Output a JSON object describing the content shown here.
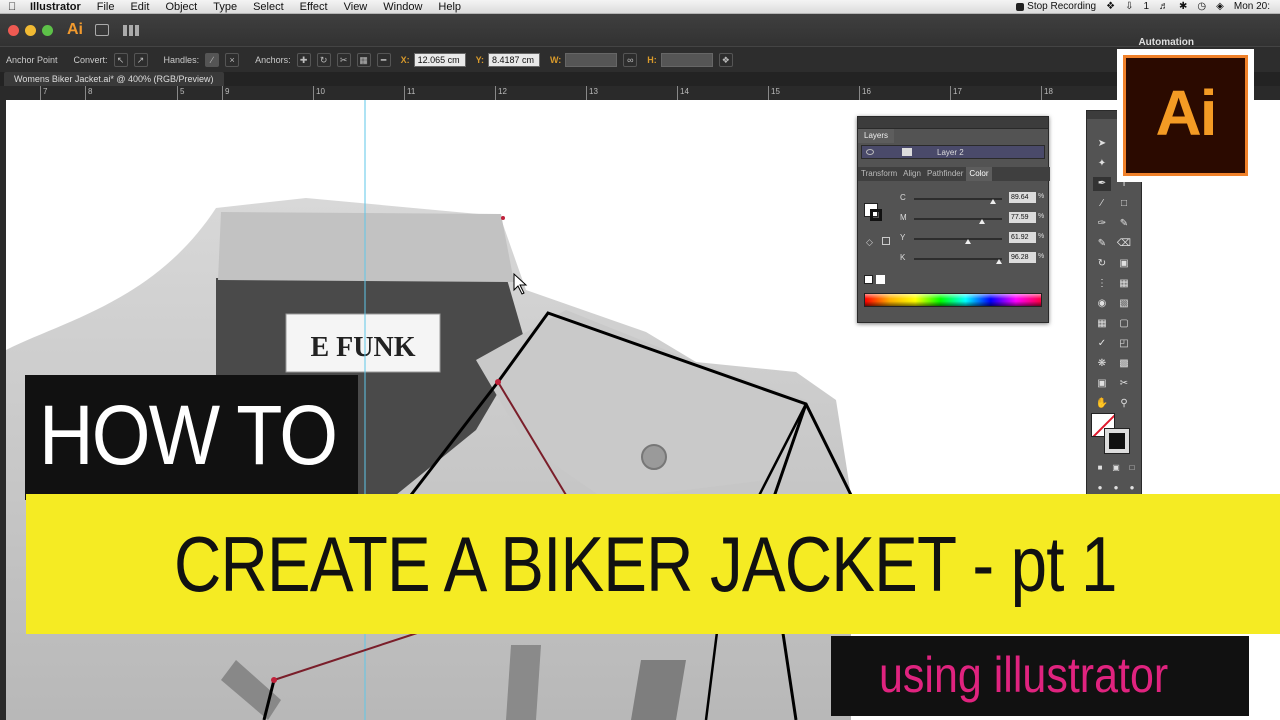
{
  "menubar": {
    "app_name": "Illustrator",
    "items": [
      "File",
      "Edit",
      "Object",
      "Type",
      "Select",
      "Effect",
      "View",
      "Window",
      "Help"
    ],
    "stop_recording": "Stop Recording",
    "clock": "Mon 20:",
    "input_badge": "1"
  },
  "appbar": {
    "logo_text": "Ai",
    "workspace": "Automation"
  },
  "control_bar": {
    "mode": "Anchor Point",
    "convert_label": "Convert:",
    "handles_label": "Handles:",
    "anchors_label": "Anchors:",
    "x_label": "X:",
    "x_value": "12.065 cm",
    "y_label": "Y:",
    "y_value": "8.4187 cm",
    "w_label": "W:",
    "h_label": "H:"
  },
  "document_tab": "Womens Biker Jacket.ai* @ 400% (RGB/Preview)",
  "ruler_labels": [
    "7",
    "8",
    "5",
    "9",
    "10",
    "11",
    "12",
    "13",
    "14",
    "15",
    "16",
    "17",
    "18",
    "19"
  ],
  "canvas": {
    "label_text": "E FUNK"
  },
  "layers_panel": {
    "title": "Layers",
    "layer_name": "Layer 2"
  },
  "color_panel": {
    "tabs": [
      "Transform",
      "Align",
      "Pathfinder",
      "Color"
    ],
    "active_tab": "Color",
    "channels": [
      {
        "name": "C",
        "value": "89.64",
        "level": 0.8964
      },
      {
        "name": "M",
        "value": "77.59",
        "level": 0.7759
      },
      {
        "name": "Y",
        "value": "61.92",
        "level": 0.6192
      },
      {
        "name": "K",
        "value": "96.28",
        "level": 0.9628
      }
    ],
    "percent_sign": "%"
  },
  "logo": {
    "text": "Ai",
    "border_color": "#f0812a",
    "text_color": "#f49b24",
    "bg_color": "#2b0a00"
  },
  "overlay": {
    "line1": "HOW TO",
    "line2": "CREATE A BIKER JACKET - pt 1",
    "line3": "using illustrator",
    "accent_yellow": "#f5eb23",
    "accent_pink": "#e0237f"
  }
}
